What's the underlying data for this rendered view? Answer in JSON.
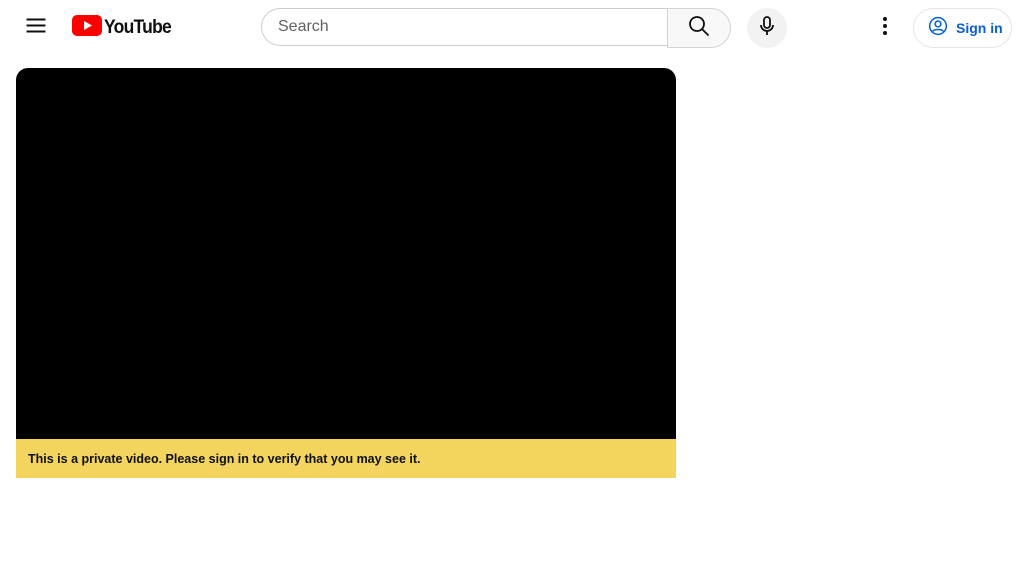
{
  "masthead": {
    "logo_text": "YouTube",
    "search": {
      "placeholder": "Search",
      "value": ""
    },
    "signin_label": "Sign in"
  },
  "player": {
    "error_message": "This is a private video. Please sign in to verify that you may see it."
  },
  "colors": {
    "brand_red": "#ff0000",
    "signin_blue": "#065fd4",
    "error_banner": "#f2d45f",
    "player_bg": "#000000"
  }
}
